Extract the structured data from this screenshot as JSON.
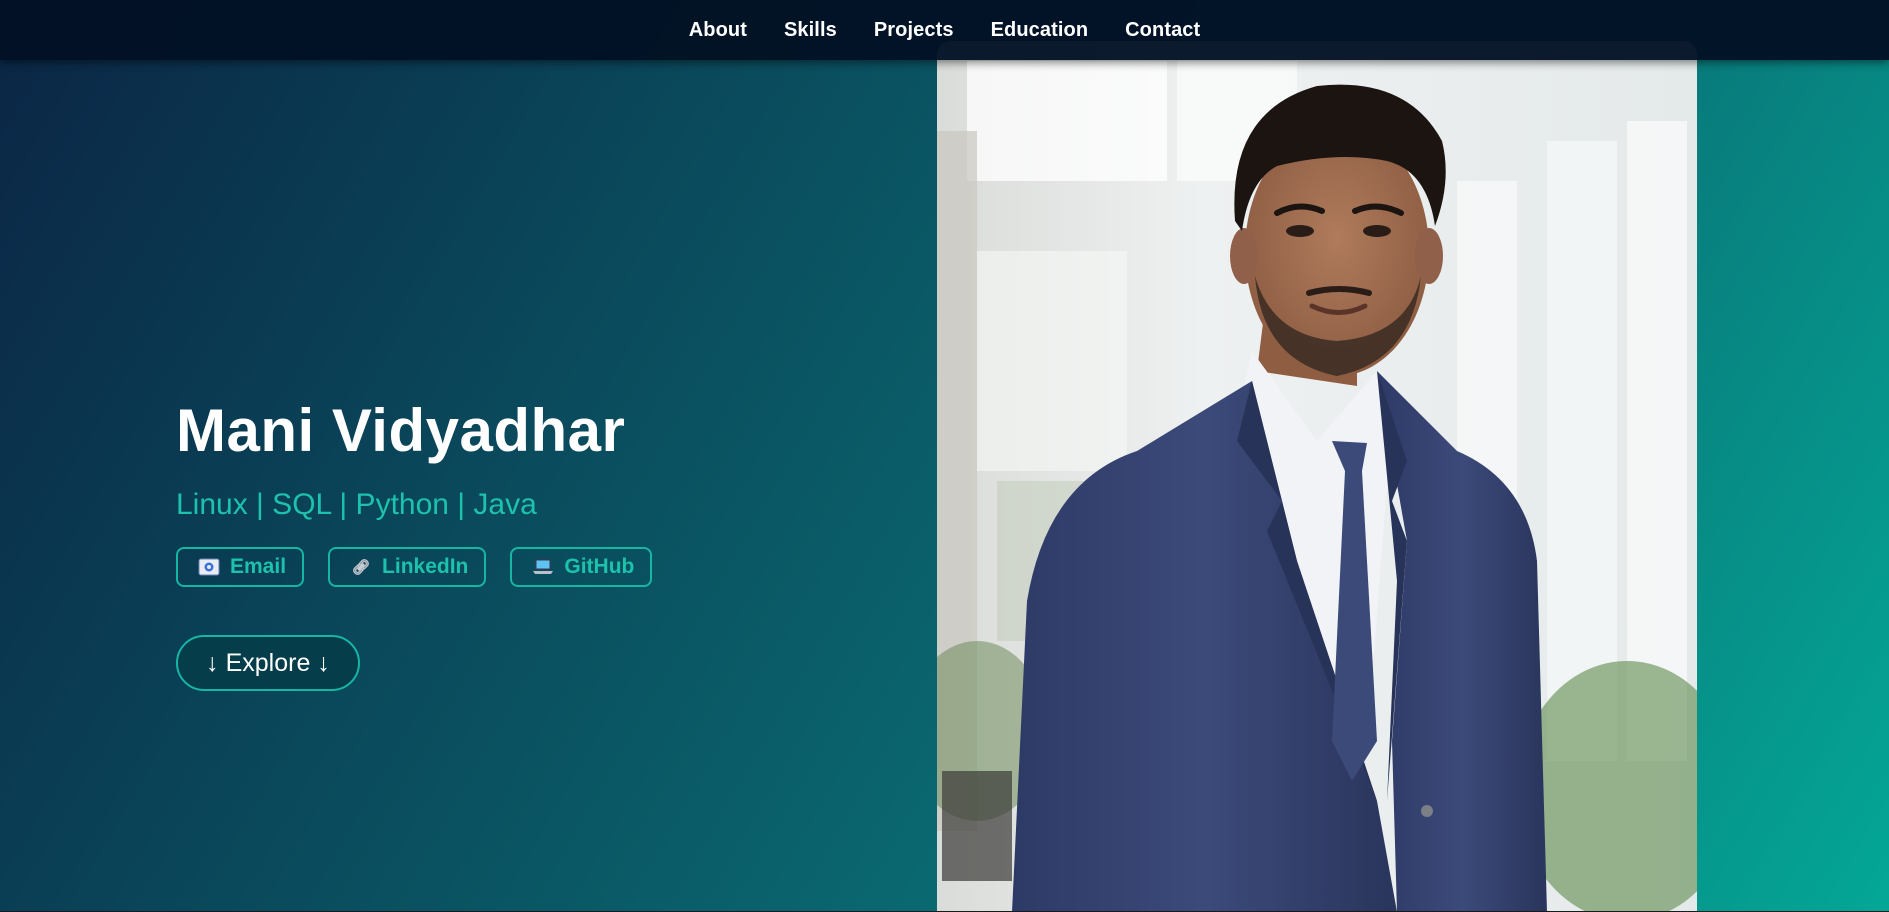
{
  "nav": {
    "items": [
      {
        "label": "About"
      },
      {
        "label": "Skills"
      },
      {
        "label": "Projects"
      },
      {
        "label": "Education"
      },
      {
        "label": "Contact"
      }
    ]
  },
  "hero": {
    "name": "Mani Vidyadhar",
    "tagline": "Linux | SQL | Python | Java",
    "links": [
      {
        "label": "Email",
        "icon": "email-icon"
      },
      {
        "label": "LinkedIn",
        "icon": "link-icon"
      },
      {
        "label": "GitHub",
        "icon": "laptop-icon"
      }
    ],
    "explore_label": "↓ Explore ↓"
  },
  "colors": {
    "accent": "#1cc2ac",
    "nav_bg": "#021124",
    "gradient_start": "#0b2545",
    "gradient_end": "#04a796"
  }
}
